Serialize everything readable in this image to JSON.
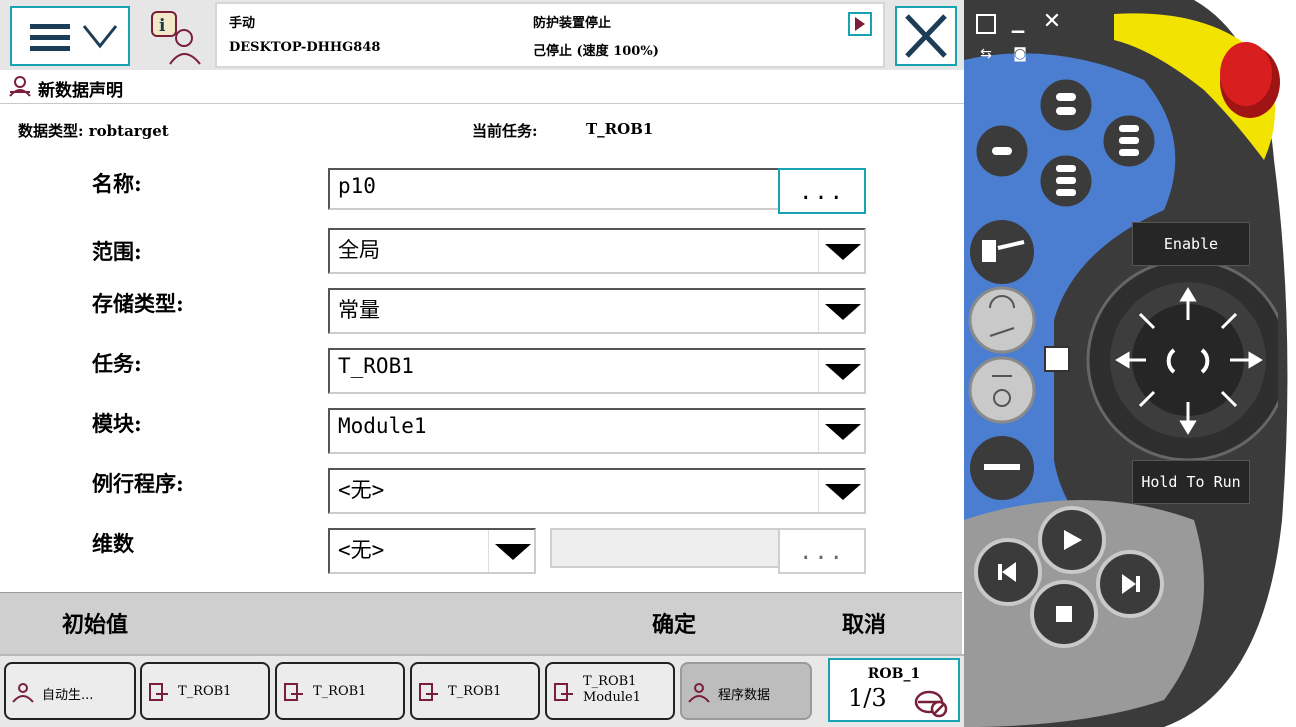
{
  "header": {
    "mode": "手动",
    "device": "DESKTOP-DHHG848",
    "state": "防护装置停止",
    "run_state": "己停止 (速度 100%)"
  },
  "page_title": "新数据声明",
  "subheader": {
    "data_type": "数据类型: robtarget",
    "current_task_label": "当前任务:",
    "current_task": "T_ROB1"
  },
  "form": {
    "name_label": "名称:",
    "name_value": "p10",
    "dots": "...",
    "scope_label": "范围:",
    "scope_value": "全局",
    "storage_label": "存储类型:",
    "storage_value": "常量",
    "task_label": "任务:",
    "task_value": "T_ROB1",
    "module_label": "模块:",
    "module_value": "Module1",
    "routine_label": "例行程序:",
    "routine_value": "<无>",
    "dim_label": "维数",
    "dim_value": "<无>"
  },
  "actions": {
    "initial_value": "初始值",
    "ok": "确定",
    "cancel": "取消"
  },
  "taskbar": {
    "items": [
      {
        "label": "自动生..."
      },
      {
        "label": "T_ROB1"
      },
      {
        "label": "T_ROB1"
      },
      {
        "label": "T_ROB1"
      },
      {
        "label": "T_ROB1\nModule1"
      },
      {
        "label": "程序数据"
      }
    ],
    "robot": "ROB_1",
    "fraction": "1/3"
  },
  "pendant": {
    "enable": "Enable",
    "hold_to_run": "Hold To Run"
  },
  "colors": {
    "accent": "#17a3b1",
    "pendant_blue": "#4b7ed0",
    "pendant_yellow": "#f2e300",
    "estop_red": "#d81e1e"
  }
}
